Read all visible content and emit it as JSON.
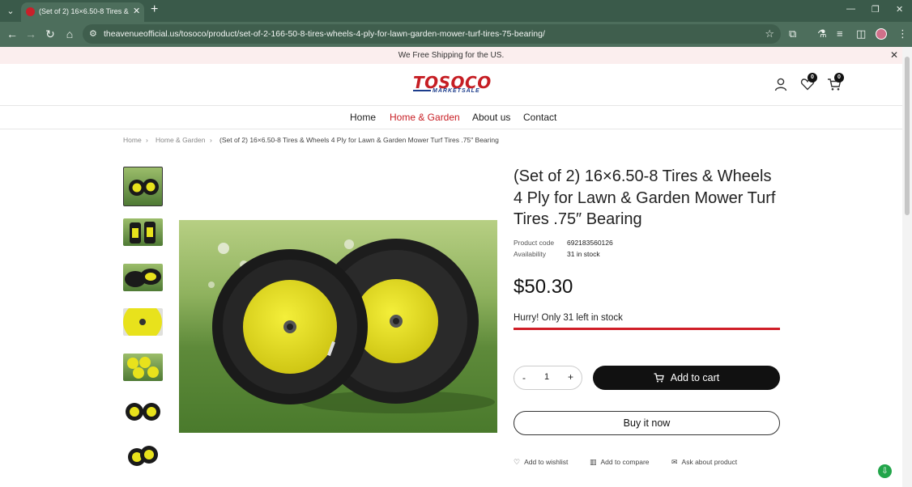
{
  "browser": {
    "tab_title": "(Set of 2) 16×6.50-8 Tires & Wh",
    "url": "theavenueofficial.us/tosoco/product/set-of-2-166-50-8-tires-wheels-4-ply-for-lawn-garden-mower-turf-tires-75-bearing/"
  },
  "announcement": {
    "text": "We Free Shipping for the US."
  },
  "logo": {
    "main": "TOSOCO",
    "sub": "MARKETSALE"
  },
  "header": {
    "wishlist_count": "0",
    "cart_count": "0"
  },
  "nav": {
    "items": [
      "Home",
      "Home & Garden",
      "About us",
      "Contact"
    ],
    "active": "Home & Garden"
  },
  "breadcrumb": {
    "home": "Home",
    "category": "Home & Garden",
    "current": "(Set of 2) 16×6.50-8 Tires & Wheels 4 Ply for Lawn & Garden Mower Turf Tires .75″ Bearing"
  },
  "product": {
    "title": "(Set of 2) 16×6.50-8 Tires & Wheels 4 Ply for Lawn & Garden Mower Turf Tires .75″ Bearing",
    "code_label": "Product code",
    "code": "692183560126",
    "availability_label": "Availability",
    "availability": "31 in stock",
    "price": "$50.30",
    "hurry": "Hurry! Only 31 left in stock",
    "stock_fraction": 1.0,
    "quantity": "1",
    "qty_minus": "-",
    "qty_plus": "+",
    "add_to_cart": "Add to cart",
    "buy_now": "Buy it now"
  },
  "actions": {
    "wishlist": "Add to wishlist",
    "compare": "Add to compare",
    "ask": "Ask about product"
  },
  "colors": {
    "accent_red": "#c81e24",
    "chrome_green": "#4d6e5c",
    "button_black": "#111111"
  }
}
